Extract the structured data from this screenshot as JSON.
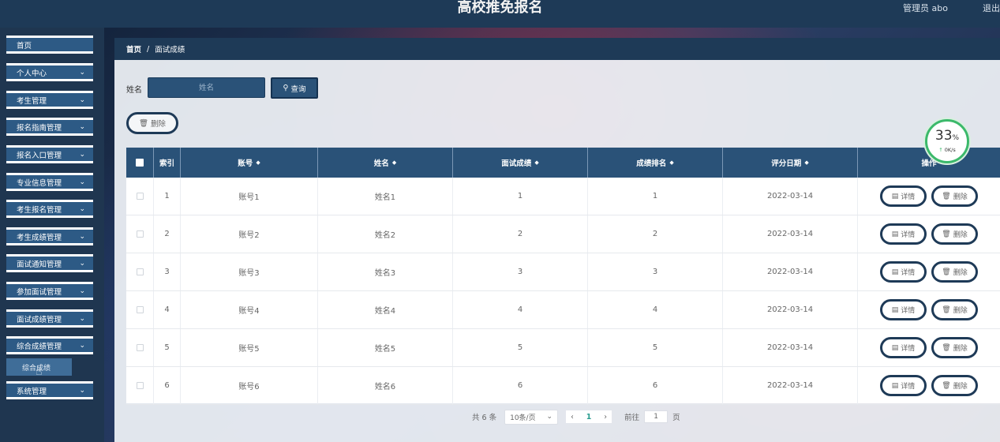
{
  "header": {
    "title": "高校推免报名",
    "admin_label": "管理员 abo",
    "logout": "退出"
  },
  "sidebar": {
    "items": [
      {
        "label": "首页",
        "chevron": false
      },
      {
        "label": "个人中心",
        "chevron": true
      },
      {
        "label": "考生管理",
        "chevron": true
      },
      {
        "label": "报名指南管理",
        "chevron": true
      },
      {
        "label": "报名入口管理",
        "chevron": true
      },
      {
        "label": "专业信息管理",
        "chevron": true
      },
      {
        "label": "考生报名管理",
        "chevron": true
      },
      {
        "label": "考生成绩管理",
        "chevron": true
      },
      {
        "label": "面试通知管理",
        "chevron": true
      },
      {
        "label": "参加面试管理",
        "chevron": true
      },
      {
        "label": "面试成绩管理",
        "chevron": true
      },
      {
        "label": "综合成绩管理",
        "chevron": true
      },
      {
        "label": "系统管理",
        "chevron": true
      }
    ],
    "submenu_label": "综合成绩"
  },
  "breadcrumb": {
    "home": "首页",
    "separator": "/",
    "current": "面试成绩"
  },
  "search": {
    "label": "姓名",
    "placeholder": "姓名",
    "button_label": "查询"
  },
  "toolbar": {
    "delete_label": "删除"
  },
  "table": {
    "columns": [
      "索引",
      "账号",
      "姓名",
      "面试成绩",
      "成绩排名",
      "评分日期",
      "操作"
    ],
    "rows": [
      {
        "index": "1",
        "account": "账号1",
        "name": "姓名1",
        "score": "1",
        "rank": "1",
        "date": "2022-03-14"
      },
      {
        "index": "2",
        "account": "账号2",
        "name": "姓名2",
        "score": "2",
        "rank": "2",
        "date": "2022-03-14"
      },
      {
        "index": "3",
        "account": "账号3",
        "name": "姓名3",
        "score": "3",
        "rank": "3",
        "date": "2022-03-14"
      },
      {
        "index": "4",
        "account": "账号4",
        "name": "姓名4",
        "score": "4",
        "rank": "4",
        "date": "2022-03-14"
      },
      {
        "index": "5",
        "account": "账号5",
        "name": "姓名5",
        "score": "5",
        "rank": "5",
        "date": "2022-03-14"
      },
      {
        "index": "6",
        "account": "账号6",
        "name": "姓名6",
        "score": "6",
        "rank": "6",
        "date": "2022-03-14"
      }
    ],
    "detail_label": "详情",
    "delete_label": "删除"
  },
  "pagination": {
    "total": "共 6 条",
    "page_size": "10条/页",
    "current_page": "1",
    "goto_label": "前往",
    "goto_value": "1",
    "page_unit": "页"
  },
  "net_widget": {
    "percent": "33",
    "percent_unit": "%",
    "speed": "0K/s"
  },
  "colors": {
    "primary": "#2a5278",
    "nav_dark": "#1e3a57",
    "accent_green": "#3cb96b"
  }
}
